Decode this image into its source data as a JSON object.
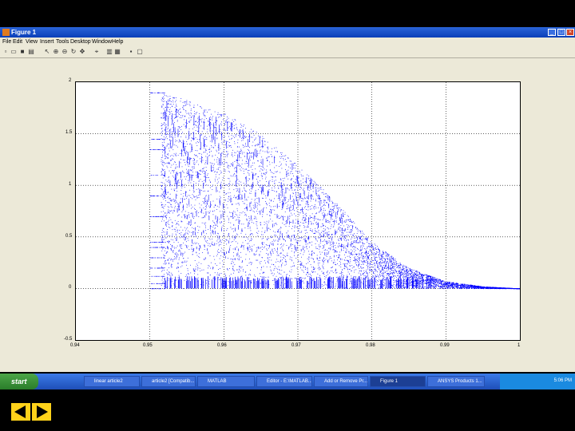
{
  "window": {
    "title": "Figure 1",
    "controls": [
      "_",
      "□",
      "×"
    ]
  },
  "menu": [
    "File",
    "Edit",
    "View",
    "Insert",
    "Tools",
    "Desktop",
    "Window",
    "Help"
  ],
  "toolbar_icons": [
    "new-file-icon",
    "open-icon",
    "save-icon",
    "print-icon",
    "pointer-icon",
    "zoom-in-icon",
    "zoom-out-icon",
    "rotate-icon",
    "pan-icon",
    "data-cursor-icon",
    "colorbar-icon",
    "legend-icon",
    "hide-plot-tools-icon",
    "show-plot-tools-icon"
  ],
  "chart_data": {
    "type": "scatter",
    "title": "",
    "xlabel": "",
    "ylabel": "",
    "xlim": [
      0.94,
      1.0
    ],
    "ylim": [
      -0.5,
      2.0
    ],
    "xticks": [
      "0.94",
      "0.95",
      "0.96",
      "0.97",
      "0.98",
      "0.99",
      "1"
    ],
    "yticks": [
      "2",
      "1.5",
      "1",
      "0.5",
      "0",
      "-0.5"
    ],
    "grid": true,
    "color": "#0000ff",
    "description_series": [
      {
        "name": "",
        "x": [
          0.95,
          0.952,
          0.952,
          0.954,
          0.956,
          0.96,
          0.965,
          0.97,
          0.975,
          0.98,
          0.985,
          0.99,
          0.995,
          1.0
        ],
        "y": [
          1.88,
          1.9,
          1.88,
          1.85,
          1.8,
          1.7,
          1.5,
          1.2,
          0.85,
          0.45,
          0.2,
          0.07,
          0.02,
          0.0
        ]
      }
    ]
  },
  "taskbar": {
    "start_label": "start",
    "items": [
      {
        "label": "linear article2",
        "active": false
      },
      {
        "label": "article2 [Compatib...",
        "active": false
      },
      {
        "label": "MATLAB",
        "active": false
      },
      {
        "label": "Editor - E:\\MATLAB...",
        "active": false
      },
      {
        "label": "Add or Remove Pr...",
        "active": false
      },
      {
        "label": "Figure 1",
        "active": true
      },
      {
        "label": "ANSYS Products 1...",
        "active": false
      }
    ],
    "clock": "5:06 PM"
  },
  "nav": [
    "previous-slide",
    "next-slide"
  ]
}
